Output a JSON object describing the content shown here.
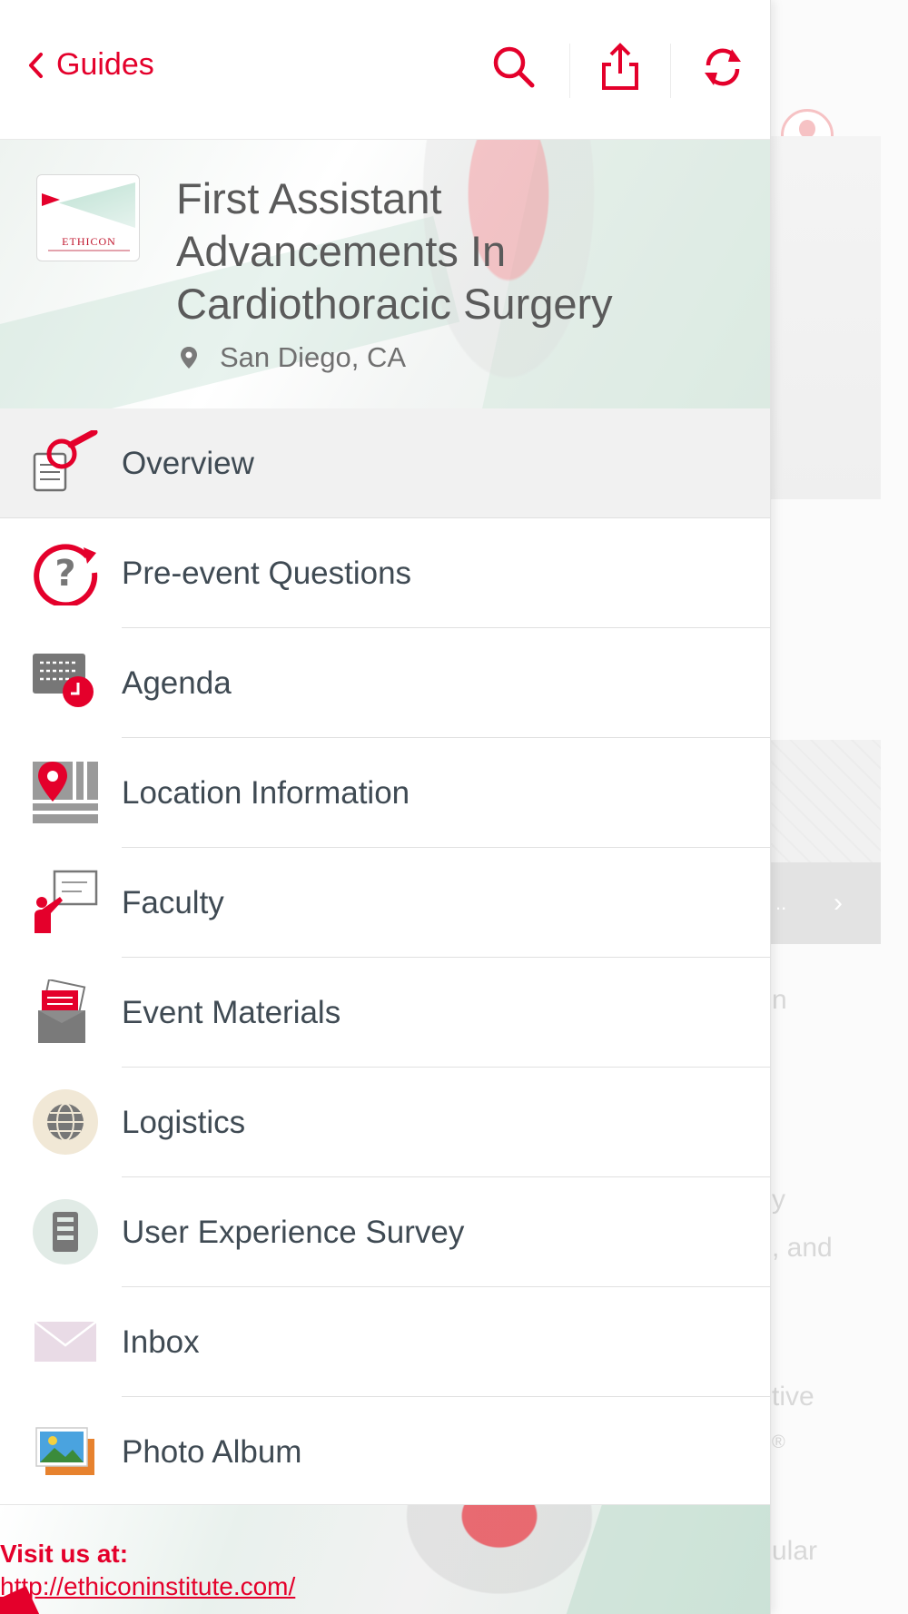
{
  "topbar": {
    "back_label": "Guides",
    "icons": [
      "search-icon",
      "share-icon",
      "refresh-icon"
    ]
  },
  "event": {
    "title_lines": [
      "First Assistant",
      "Advancements In",
      "Cardiothoracic Surgery"
    ],
    "location": "San Diego, CA",
    "logo_text": "ETHICON"
  },
  "menu": {
    "items": [
      {
        "label": "Overview",
        "icon": "overview-icon",
        "active": true
      },
      {
        "label": "Pre-event Questions",
        "icon": "question-icon",
        "active": false
      },
      {
        "label": "Agenda",
        "icon": "agenda-icon",
        "active": false
      },
      {
        "label": "Location Information",
        "icon": "map-pin-icon",
        "active": false
      },
      {
        "label": "Faculty",
        "icon": "presenter-icon",
        "active": false
      },
      {
        "label": "Event Materials",
        "icon": "documents-icon",
        "active": false
      },
      {
        "label": "Logistics",
        "icon": "globe-icon",
        "active": false
      },
      {
        "label": "User Experience Survey",
        "icon": "survey-icon",
        "active": false
      },
      {
        "label": "Inbox",
        "icon": "envelope-icon",
        "active": false
      },
      {
        "label": "Photo Album",
        "icon": "photo-icon",
        "active": false
      }
    ]
  },
  "footer": {
    "line1": "Visit us at:",
    "line2": "http://ethiconinstitute.com/"
  },
  "background": {
    "fragments": [
      "n",
      "y",
      ", and",
      "tive",
      "®",
      "ular",
      ".."
    ]
  },
  "colors": {
    "accent": "#e4002b",
    "text": "#3f4a53",
    "active_row": "#f1f1f1"
  }
}
